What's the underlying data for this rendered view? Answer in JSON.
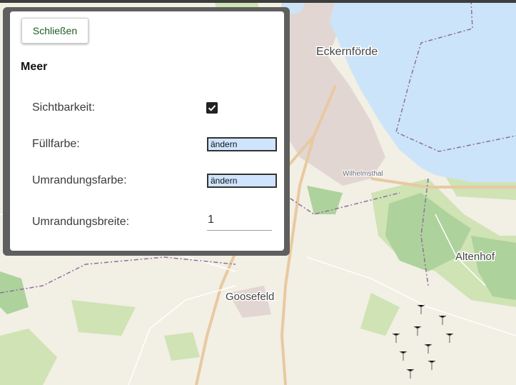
{
  "map": {
    "places": {
      "eckernfoerde": "Eckernförde",
      "wilhelmsthal": "Wilhelmsthal",
      "goosefeld": "Goosefeld",
      "altenhof": "Altenhof"
    },
    "colors": {
      "water": "#cbe4f9",
      "land": "#f2efe4",
      "green": "#cfe3b5",
      "forest": "#aed29b",
      "urban": "#e2d6d3",
      "road": "#e8c9a1",
      "boundary": "#8e6f9e"
    }
  },
  "dialog": {
    "close_label": "Schließen",
    "title": "Meer",
    "visibility_label": "Sichtbarkeit:",
    "visibility_checked": true,
    "fill_label": "Füllfarbe:",
    "fill_button": "ändern",
    "stroke_label": "Umrandungsfarbe:",
    "stroke_button": "ändern",
    "width_label": "Umrandungsbreite:",
    "width_value": "1"
  },
  "colors": {
    "accent_text": "#1b5e20",
    "color_button_bg": "#cfe5ff"
  }
}
